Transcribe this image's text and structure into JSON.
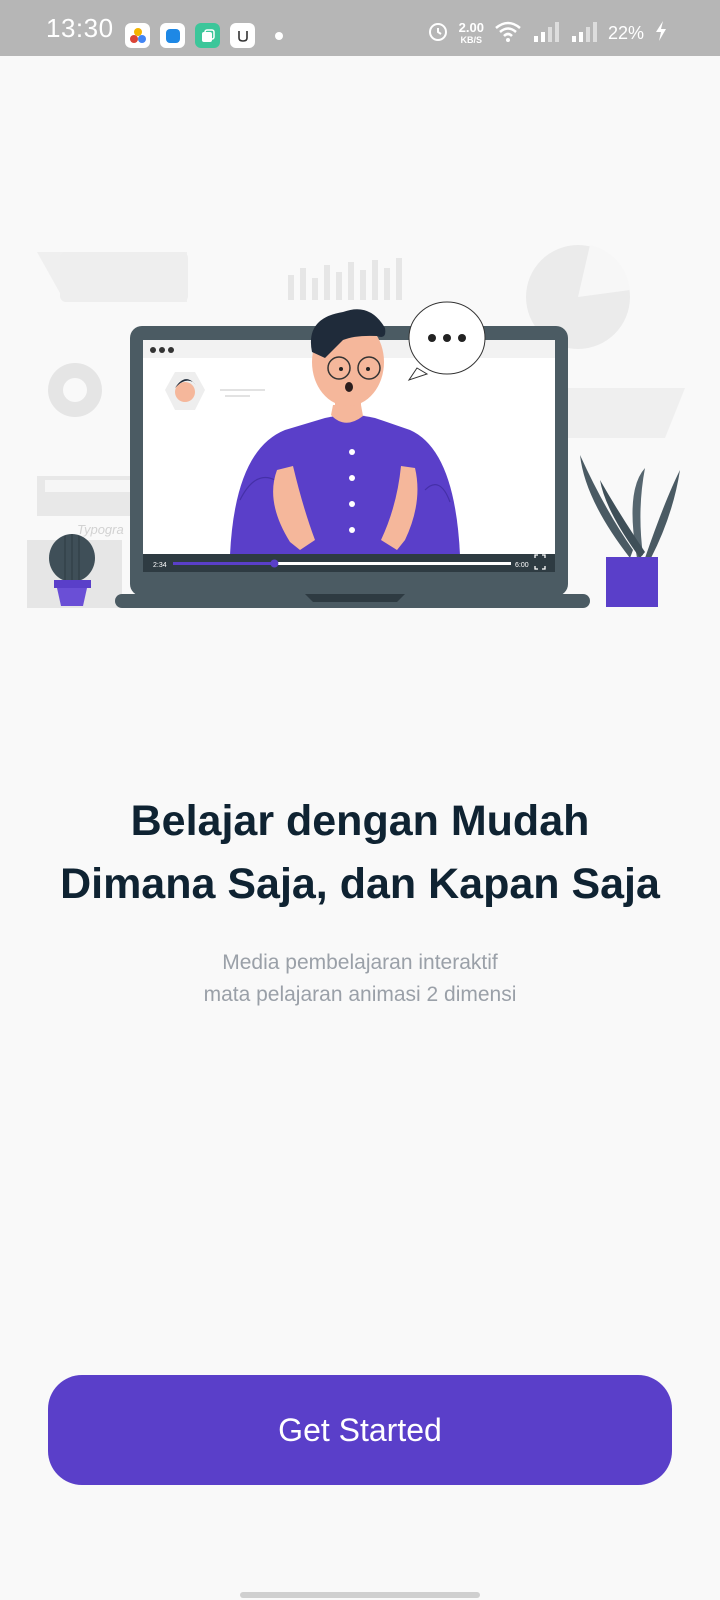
{
  "status_bar": {
    "time": "13:30",
    "net_speed_value": "2.00",
    "net_speed_unit": "KB/S",
    "battery": "22%",
    "app_icons": [
      "photos-icon",
      "files-icon",
      "copy-icon",
      "u-app-icon"
    ],
    "status_icons": [
      "alarm-icon",
      "wifi-icon",
      "signal-icon",
      "signal-icon",
      "charging-icon"
    ]
  },
  "illustration": {
    "player_elapsed": "2:34",
    "player_duration": "6:00",
    "progress_fraction": 0.3,
    "sign_text": "Typogra"
  },
  "onboarding": {
    "title_line1": "Belajar dengan Mudah",
    "title_line2": "Dimana Saja, dan Kapan Saja",
    "subtitle_line1": "Media pembelajaran interaktif",
    "subtitle_line2": "mata pelajaran animasi 2 dimensi",
    "cta_label": "Get Started"
  },
  "colors": {
    "accent": "#5a3fc9",
    "heading": "#0f2332",
    "muted": "#9aa0a8",
    "status_bar": "#b6b6b6",
    "background": "#f9f9f9"
  }
}
